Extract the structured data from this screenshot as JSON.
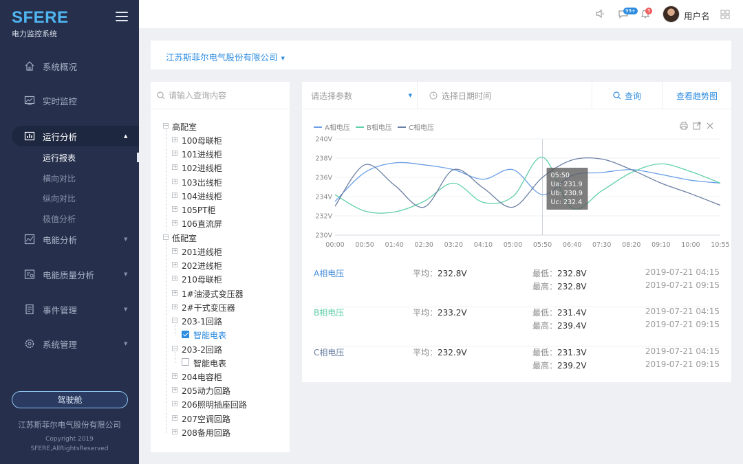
{
  "app": {
    "brand": "SFERE",
    "subtitle": "电力监控系统"
  },
  "nav": [
    {
      "label": "系统概况",
      "icon": "home-icon"
    },
    {
      "label": "实时监控",
      "icon": "monitor-icon"
    },
    {
      "label": "运行分析",
      "icon": "bar-chart-icon",
      "active": true
    },
    {
      "label": "电能分析",
      "icon": "line-chart-icon"
    },
    {
      "label": "电能质量分析",
      "icon": "quality-icon"
    },
    {
      "label": "事件管理",
      "icon": "document-icon"
    },
    {
      "label": "系统管理",
      "icon": "gear-icon"
    }
  ],
  "subnav": [
    "运行报表",
    "横向对比",
    "纵向对比",
    "极值分析"
  ],
  "sidebar_footer": {
    "cockpit": "驾驶舱",
    "company": "江苏斯菲尔电气股份有限公司",
    "copyright1": "Copyright 2019",
    "copyright2": "SFERE,AllRightsReserved"
  },
  "header": {
    "badge_messages": "99+",
    "badge_alerts": "5",
    "username": "用户名"
  },
  "company_selector": "江苏斯菲尔电气股份有限公司",
  "tree": {
    "search_placeholder": "请输入查询内容",
    "nodes": [
      "高配室",
      "100母联柜",
      "101进线柜",
      "102进线柜",
      "103出线柜",
      "104进线柜",
      "105PT柜",
      "106直流屏",
      "低配室",
      "201进线柜",
      "202进线柜",
      "210母联柜",
      "1#油浸式变压器",
      "2#干式变压器",
      "203-1回路",
      "智能电表",
      "203-2回路",
      "智能电表",
      "204电容柜",
      "205动力回路",
      "206照明插座回路",
      "207空调回路",
      "208备用回路"
    ]
  },
  "filter": {
    "param_placeholder": "请选择参数",
    "date_placeholder": "选择日期时间",
    "query": "查询",
    "trend": "查看趋势图"
  },
  "chart_data": {
    "type": "line",
    "legend": [
      "A相电压",
      "B相电压",
      "C相电压"
    ],
    "colors": [
      "#6a9ee6",
      "#5fcfa7",
      "#6b7fa3"
    ],
    "x": [
      "00:00",
      "00:50",
      "01:40",
      "02:30",
      "03:20",
      "04:10",
      "05:00",
      "05:50",
      "06:40",
      "07:30",
      "08:20",
      "09:10",
      "10:00",
      "10:55"
    ],
    "ylim": [
      230,
      240
    ],
    "yticks": [
      "240V",
      "238V",
      "236V",
      "234V",
      "232V",
      "230V"
    ],
    "series": [
      {
        "name": "A相电压",
        "values": [
          233.5,
          236.5,
          237.5,
          237.3,
          236.8,
          235.8,
          236.8,
          234.2,
          236.2,
          236.5,
          236.8,
          236.3,
          235.7,
          235.4
        ]
      },
      {
        "name": "B相电压",
        "values": [
          234.2,
          232.5,
          232.4,
          233.5,
          235.4,
          233.4,
          234.0,
          238.1,
          232.8,
          234.6,
          236.5,
          237.4,
          236.6,
          235.4
        ]
      },
      {
        "name": "C相电压",
        "values": [
          233.0,
          237.3,
          235.2,
          232.9,
          236.8,
          234.9,
          232.9,
          236.0,
          237.8,
          237.9,
          236.8,
          235.4,
          234.3,
          233.1
        ]
      }
    ],
    "tooltip": {
      "time": "05:50",
      "ua": "Ua: 231.9",
      "ub": "Ub: 230.9",
      "uc": "Uc: 232.4"
    }
  },
  "stats": [
    {
      "name": "A相电压",
      "avg_label": "平均：",
      "avg": "232.8V",
      "min_label": "最低：",
      "min": "232.8V",
      "max_label": "最高：",
      "max": "232.8V",
      "t1": "2019-07-21 04:15",
      "t2": "2019-07-21 09:15",
      "color": "#4a90d9"
    },
    {
      "name": "B相电压",
      "avg_label": "平均：",
      "avg": "233.2V",
      "min_label": "最低：",
      "min": "231.4V",
      "max_label": "最高：",
      "max": "239.4V",
      "t1": "2019-07-21 04:15",
      "t2": "2019-07-21 09:15",
      "color": "#5fcfa7"
    },
    {
      "name": "C相电压",
      "avg_label": "平均：",
      "avg": "232.9V",
      "min_label": "最低：",
      "min": "231.3V",
      "max_label": "最高：",
      "max": "239.2V",
      "t1": "2019-07-21 04:15",
      "t2": "2019-07-21 09:15",
      "color": "#6b7fa3"
    }
  ]
}
